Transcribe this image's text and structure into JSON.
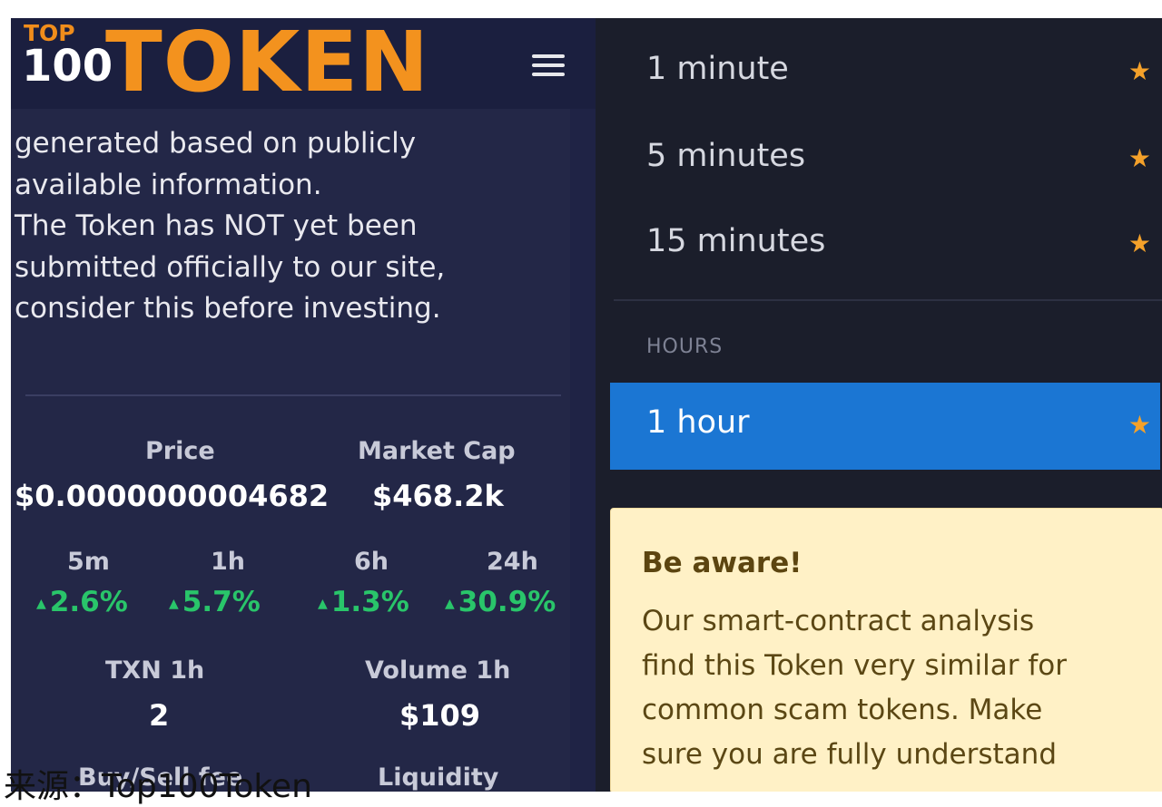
{
  "header": {
    "logo_top": "TOP",
    "logo_number": "100",
    "logo_word": "TOKEN",
    "menu_icon": "hamburger-icon"
  },
  "notice": {
    "line1": "generated based on publicly",
    "line2": "available information.",
    "line3": "The Token has NOT yet been",
    "line4": "submitted officially to our site,",
    "line5": "consider this before investing."
  },
  "stats": {
    "price_label": "Price",
    "price_value": "$0.0000000004682",
    "mcap_label": "Market Cap",
    "mcap_value": "$468.2k",
    "changes": [
      {
        "label": "5m",
        "value": "2.6%"
      },
      {
        "label": "1h",
        "value": "5.7%"
      },
      {
        "label": "6h",
        "value": "1.3%"
      },
      {
        "label": "24h",
        "value": "30.9%"
      }
    ],
    "up_color": "#29c56a",
    "txn_label": "TXN 1h",
    "txn_value": "2",
    "volume_label": "Volume 1h",
    "volume_value": "$109",
    "fee_label": "Buy/Sell fee",
    "liquidity_label": "Liquidity"
  },
  "timeframes": {
    "minutes": [
      {
        "label": "1 minute"
      },
      {
        "label": "5 minutes"
      },
      {
        "label": "15 minutes"
      }
    ],
    "hours_heading": "HOURS",
    "hours": [
      {
        "label": "1 hour",
        "active": true
      }
    ],
    "star_icon": "star-icon",
    "star_color": "#f4a12a",
    "active_color": "#1b76d3"
  },
  "warning": {
    "title": "Be aware!",
    "line1": "Our smart-contract analysis",
    "line2": "find this Token very similar for",
    "line3": "common scam tokens. Make",
    "line4": "sure you are fully understand"
  },
  "watermark": "来源：Top100Token"
}
